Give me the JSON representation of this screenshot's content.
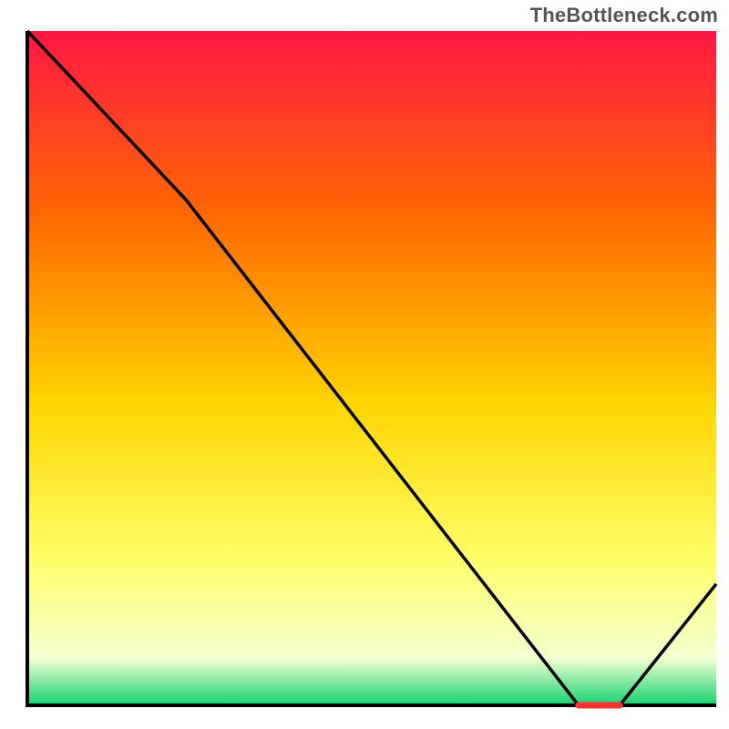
{
  "watermark": "TheBottleneck.com",
  "colors": {
    "gradient_top": "#ff1744",
    "gradient_upper_mid": "#ff6a00",
    "gradient_mid": "#ffd400",
    "gradient_lower_mid": "#ffff66",
    "gradient_near_bottom": "#f3ffd0",
    "gradient_bottom": "#14d170",
    "axis": "#000000",
    "line": "#000000",
    "marker": "#ff3030"
  },
  "chart_data": {
    "type": "line",
    "title": "",
    "xlabel": "",
    "ylabel": "",
    "xlim": [
      0,
      100
    ],
    "ylim": [
      0,
      100
    ],
    "x": [
      0,
      23,
      80,
      86,
      100
    ],
    "values": [
      100,
      75,
      0,
      0,
      18
    ],
    "marker": {
      "x_start": 80,
      "x_end": 86,
      "y": 0,
      "label": ""
    },
    "notes": "No axis tick labels, titles, or legend are rendered in the source image. Values are read proportionally from the plotted line relative to the axes frame."
  }
}
